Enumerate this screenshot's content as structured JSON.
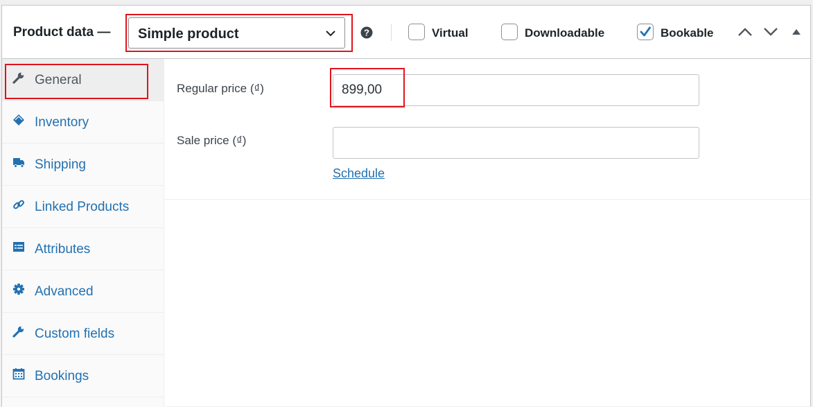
{
  "header": {
    "title": "Product data —",
    "product_type": {
      "selected": "Simple product"
    },
    "options": [
      {
        "label": "Virtual",
        "checked": false
      },
      {
        "label": "Downloadable",
        "checked": false
      },
      {
        "label": "Bookable",
        "checked": true
      }
    ],
    "icons": [
      "help-icon",
      "chevron-down-icon",
      "move-up-icon",
      "move-down-icon",
      "toggle-panel-icon"
    ]
  },
  "tabs": [
    {
      "label": "General",
      "icon": "wrench-icon",
      "active": true
    },
    {
      "label": "Inventory",
      "icon": "tag-icon",
      "active": false
    },
    {
      "label": "Shipping",
      "icon": "truck-icon",
      "active": false
    },
    {
      "label": "Linked Products",
      "icon": "link-icon",
      "active": false
    },
    {
      "label": "Attributes",
      "icon": "list-icon",
      "active": false
    },
    {
      "label": "Advanced",
      "icon": "gear-icon",
      "active": false
    },
    {
      "label": "Custom fields",
      "icon": "wrench-icon",
      "active": false
    },
    {
      "label": "Bookings",
      "icon": "calendar-icon",
      "active": false
    }
  ],
  "general": {
    "regular_price": {
      "label": "Regular price (₫)",
      "value": "899,00"
    },
    "sale_price": {
      "label": "Sale price (₫)",
      "value": ""
    },
    "schedule_link": "Schedule"
  },
  "colors": {
    "accent": "#2271b1",
    "highlight": "#e0141c",
    "checkbox_check": "#2271b1"
  }
}
